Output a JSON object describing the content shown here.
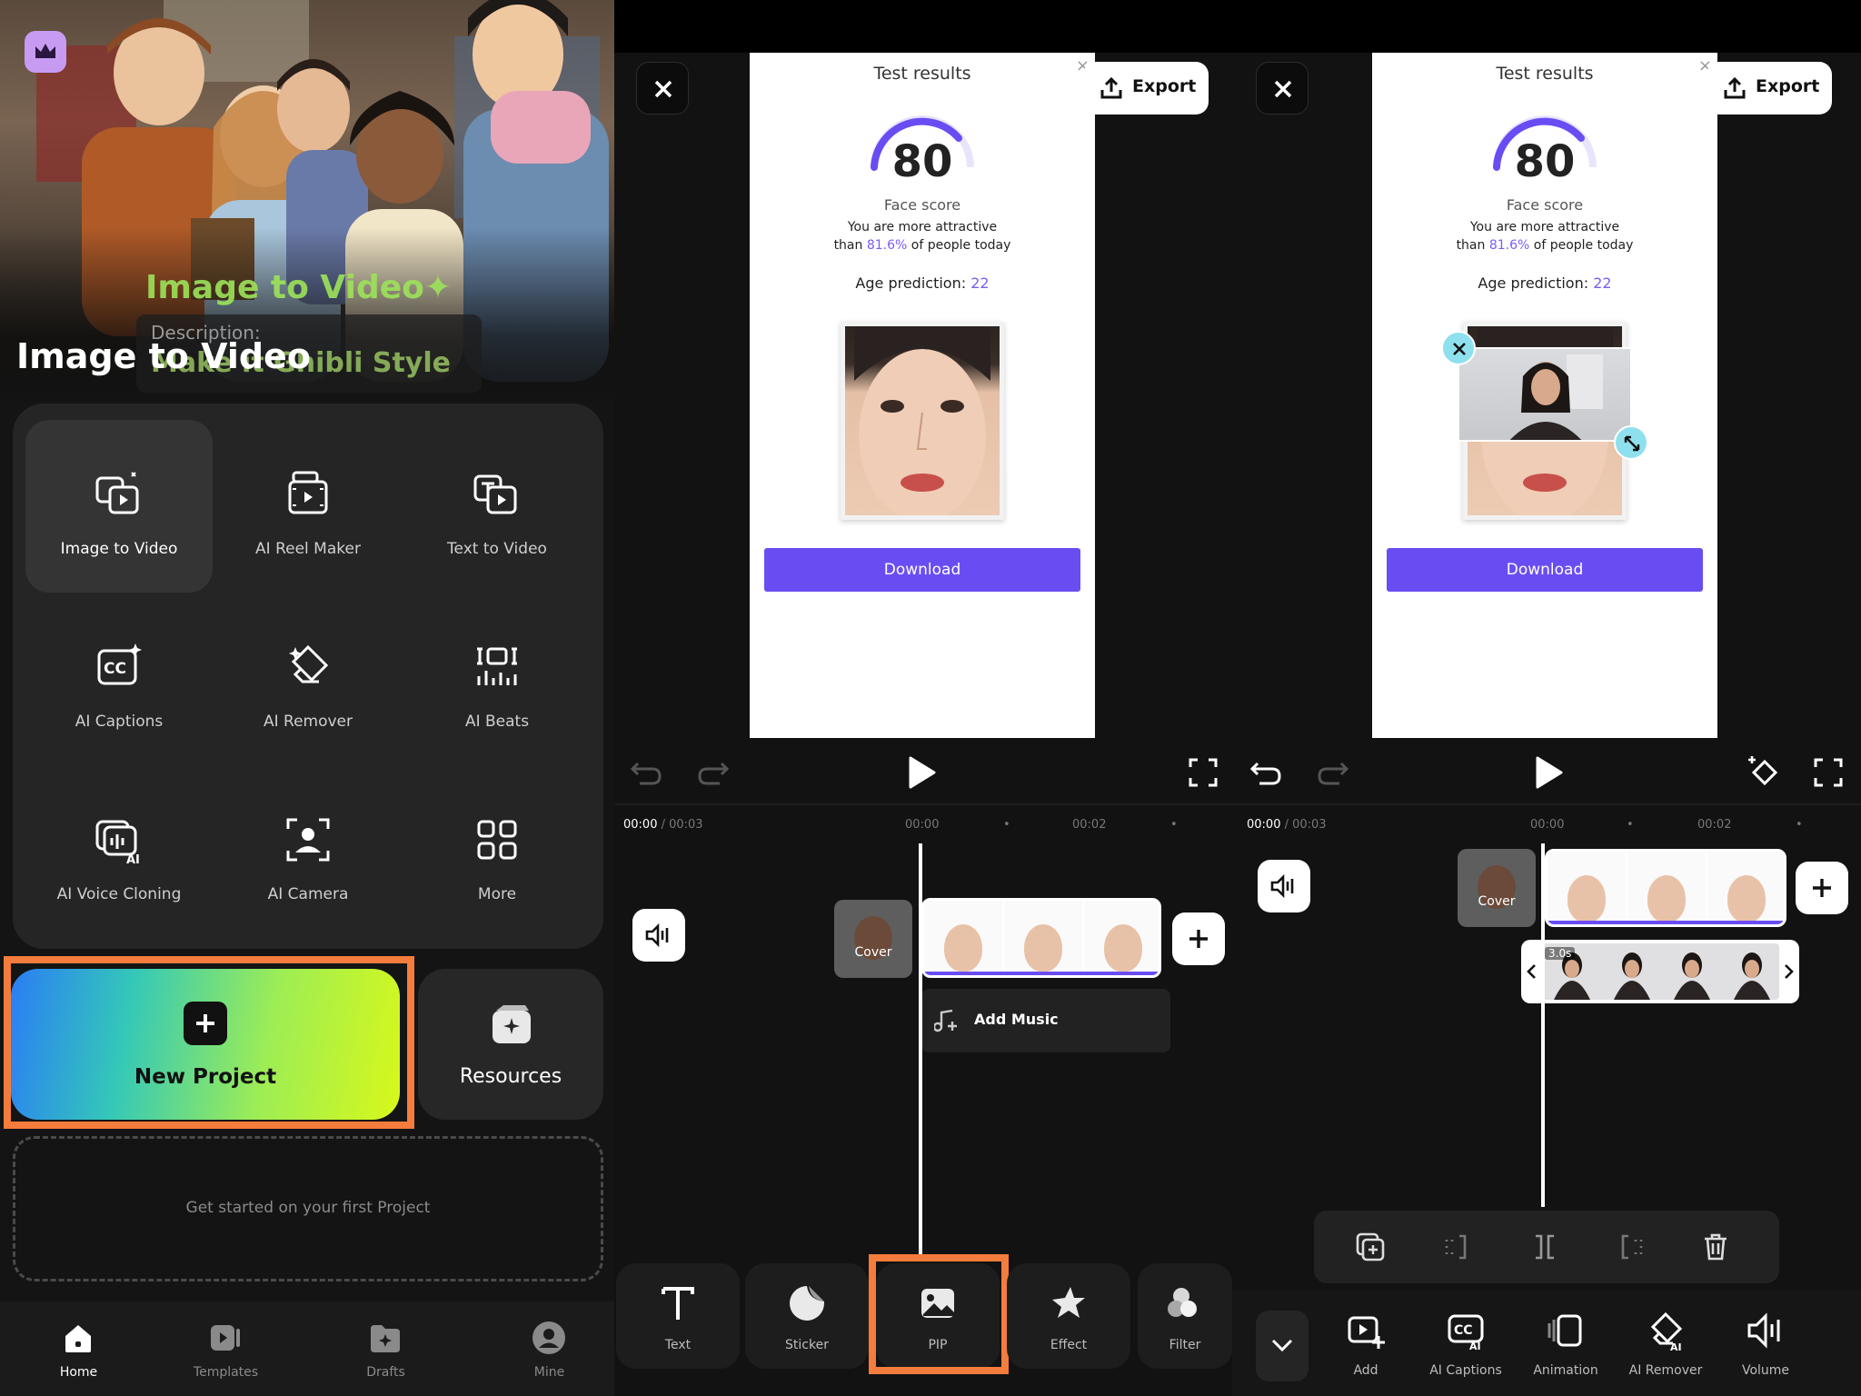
{
  "home": {
    "hero_overlay_title": "Image to Video✦",
    "hero_overlay_desc_label": "Description:",
    "hero_overlay_desc_value": "Make it Ghibli Style",
    "hero_title": "Image to Video",
    "tools": [
      {
        "label": "Image to Video",
        "icon": "image-to-video-icon"
      },
      {
        "label": "AI Reel Maker",
        "icon": "reel-maker-icon"
      },
      {
        "label": "Text to Video",
        "icon": "text-to-video-icon"
      },
      {
        "label": "AI Captions",
        "icon": "captions-icon"
      },
      {
        "label": "AI Remover",
        "icon": "eraser-icon"
      },
      {
        "label": "AI Beats",
        "icon": "beats-icon"
      },
      {
        "label": "AI Voice Cloning",
        "icon": "voice-cloning-icon"
      },
      {
        "label": "AI Camera",
        "icon": "camera-icon"
      },
      {
        "label": "More",
        "icon": "more-grid-icon"
      }
    ],
    "new_project": "New Project",
    "resources": "Resources",
    "empty_hint": "Get started on your first Project",
    "nav": [
      {
        "label": "Home",
        "icon": "home-icon"
      },
      {
        "label": "Templates",
        "icon": "templates-icon"
      },
      {
        "label": "Drafts",
        "icon": "drafts-icon"
      },
      {
        "label": "Mine",
        "icon": "profile-icon"
      }
    ],
    "accent_highlight": "#f47c3c"
  },
  "editor": {
    "export": "Export",
    "preview": {
      "title": "Test results",
      "score": "80",
      "score_label": "Face score",
      "line1": "You are more attractive",
      "line2_prefix": "than ",
      "line2_pct": "81.6%",
      "line2_suffix": " of people today",
      "age_label": "Age prediction: ",
      "age_value": "22",
      "download": "Download"
    },
    "time_current": "00:00",
    "time_total": " / 00:03",
    "tick_0": "00:00",
    "tick_2": "00:02",
    "cover": "Cover",
    "add_music": "Add Music",
    "pip_duration": "3.0s",
    "toolbar": [
      {
        "label": "Text",
        "icon": "text-icon"
      },
      {
        "label": "Sticker",
        "icon": "sticker-icon"
      },
      {
        "label": "PIP",
        "icon": "pip-icon"
      },
      {
        "label": "Effect",
        "icon": "effect-icon"
      },
      {
        "label": "Filter",
        "icon": "filter-icon"
      }
    ],
    "toolbar2": [
      {
        "label": "Add",
        "icon": "add-clip-icon"
      },
      {
        "label": "AI Captions",
        "icon": "captions-icon"
      },
      {
        "label": "Animation",
        "icon": "animation-icon"
      },
      {
        "label": "AI Remover",
        "icon": "eraser-icon"
      },
      {
        "label": "Volume",
        "icon": "volume-icon"
      }
    ],
    "accent": "#6a4df2"
  }
}
